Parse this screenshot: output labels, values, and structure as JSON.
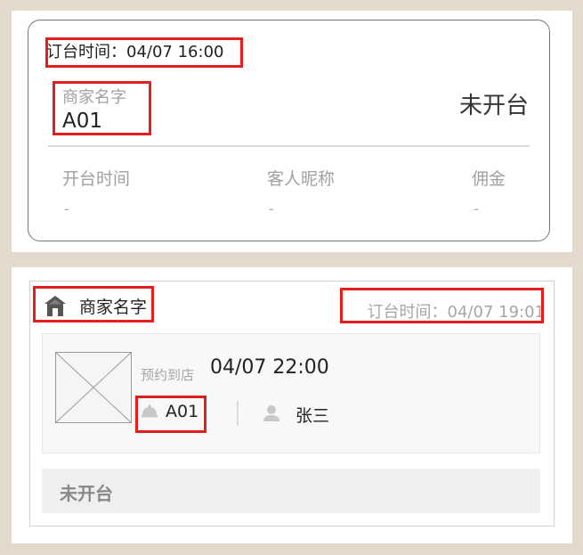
{
  "card1": {
    "order_time_label": "订台时间：",
    "order_time_value": "04/07 16:00",
    "merchant_label": "商家名字",
    "table_number": "A01",
    "status": "未开台",
    "columns": [
      {
        "header": "开台时间",
        "value": "-"
      },
      {
        "header": "客人昵称",
        "value": "-"
      },
      {
        "header": "佣金",
        "value": "-"
      }
    ]
  },
  "card2": {
    "merchant_name": "商家名字",
    "order_time_label": "订台时间：",
    "order_time_value": "04/07 19:01",
    "reserve_label": "预约到店",
    "reserve_time": "04/07 22:00",
    "table_number": "A01",
    "guest_name": "张三",
    "status": "未开台"
  },
  "icons": [
    "home-icon",
    "bell-icon",
    "user-icon",
    "image-placeholder-icon"
  ],
  "colors": {
    "highlight_box": "#e41d1d",
    "background": "#e3dacd"
  }
}
